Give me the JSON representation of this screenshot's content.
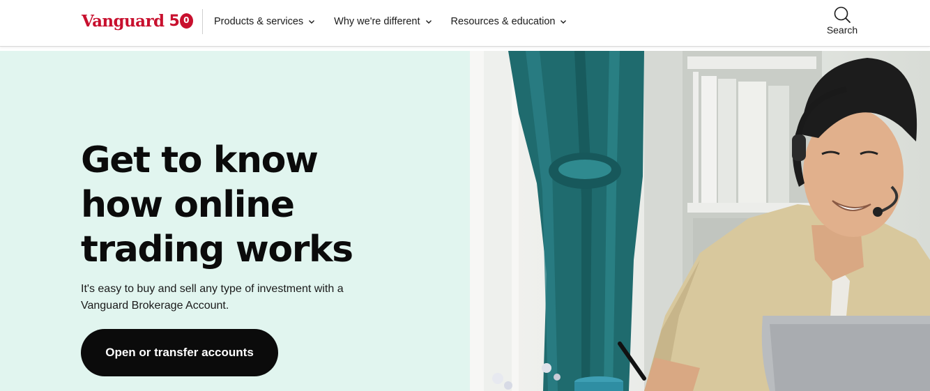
{
  "header": {
    "logo": {
      "wordmark": "Vanguard",
      "anniversary_five": "5",
      "anniversary_zero": "0"
    },
    "nav": [
      {
        "label": "Products & services",
        "icon": "chevron-down-icon"
      },
      {
        "label": "Why we're different",
        "icon": "chevron-down-icon"
      },
      {
        "label": "Resources & education",
        "icon": "chevron-down-icon"
      }
    ],
    "search": {
      "label": "Search",
      "icon": "search-icon"
    }
  },
  "hero": {
    "title_lines": [
      "Get to know",
      "how online",
      "trading works"
    ],
    "subtitle_lines": [
      "It's easy to buy and sell any type of investment with a",
      "Vanguard Brokerage Account."
    ],
    "cta_label": "Open or transfer accounts",
    "image": "man-with-headset-at-laptop"
  },
  "colors": {
    "brand_red": "#c8102e",
    "hero_background": "#e1f5ef",
    "cta_background": "#0b0b0b",
    "cta_text": "#ffffff"
  }
}
